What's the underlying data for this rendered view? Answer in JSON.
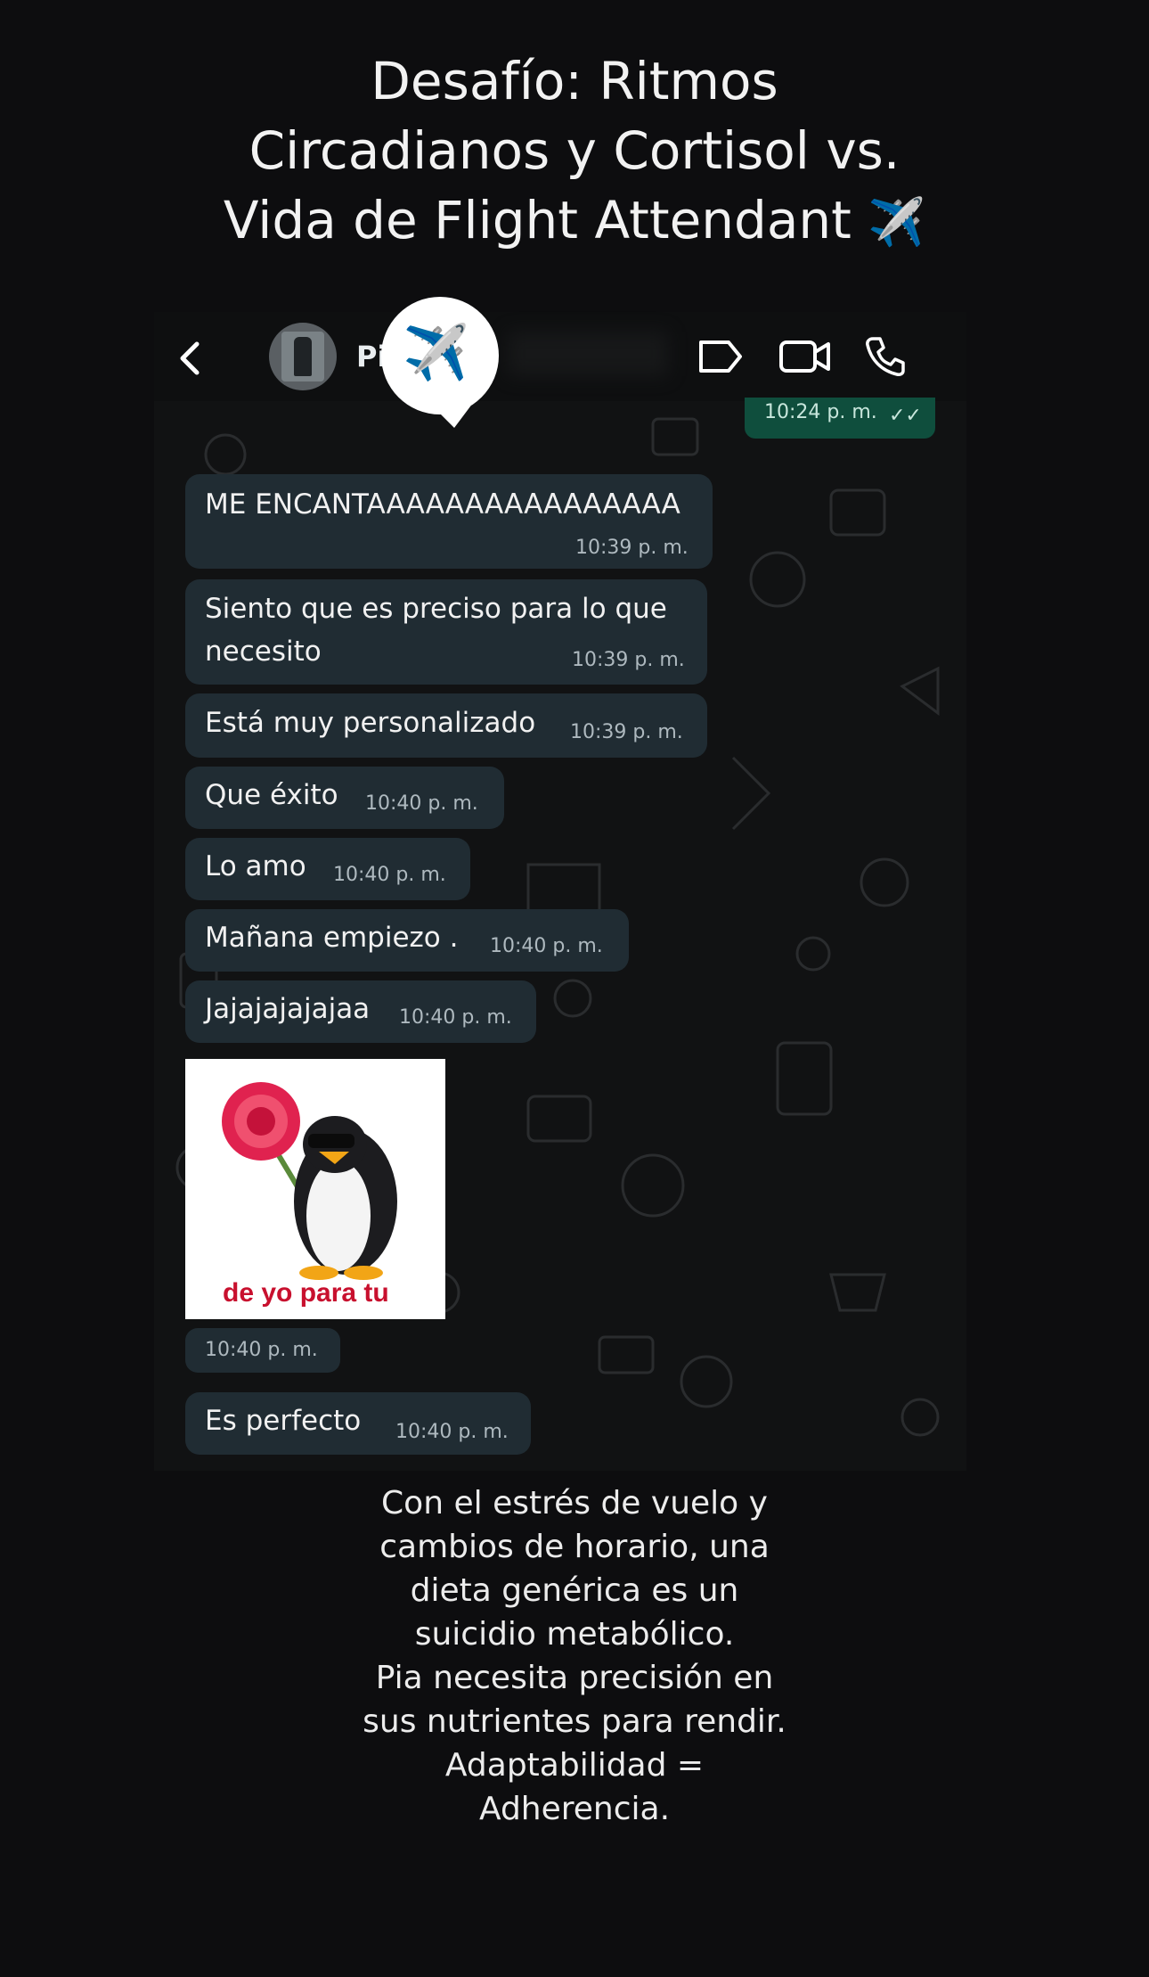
{
  "title": {
    "lines": [
      "Desafío: Ritmos",
      "Circadianos y Cortisol vs.",
      "Vida de Flight Attendant"
    ],
    "emoji": "✈️"
  },
  "chat_header": {
    "contact_name": "Pi",
    "icons": [
      "back-icon",
      "avatar",
      "airplane-sticker",
      "label-icon",
      "video-call-icon",
      "voice-call-icon"
    ],
    "badge_emoji": "✈️"
  },
  "sent_message": {
    "time": "10:24 p. m.",
    "ticks": "✓✓"
  },
  "messages": [
    {
      "text": "ME ENCANTAAAAAAAAAAAAAAAA",
      "time": "10:39 p. m."
    },
    {
      "text_line1": "Siento que es preciso para lo que",
      "text_line2": "necesito",
      "time": "10:39 p. m."
    },
    {
      "text": "Está muy personalizado",
      "time": "10:39 p. m."
    },
    {
      "text": "Que éxito",
      "time": "10:40 p. m."
    },
    {
      "text": "Lo amo",
      "time": "10:40 p. m."
    },
    {
      "text": "Mañana empiezo .",
      "time": "10:40 p. m."
    },
    {
      "text": "Jajajajajajaa",
      "time": "10:40 p. m."
    },
    {
      "text": "Es perfecto",
      "time": "10:40 p. m."
    }
  ],
  "sticker": {
    "caption": "de yo para tu",
    "time": "10:40 p. m."
  },
  "caption": {
    "lines": [
      "Con el estrés de vuelo y",
      "cambios de horario, una",
      "dieta genérica es un",
      "suicidio metabólico.",
      "Pia necesita precisión en",
      "sus nutrientes para rendir.",
      "Adaptabilidad =",
      "Adherencia."
    ]
  },
  "colors": {
    "background": "#0d0d0f",
    "incoming_bubble": "#202c33",
    "outgoing_bubble": "#0f4e3d",
    "sticker_text": "#c8102e"
  }
}
